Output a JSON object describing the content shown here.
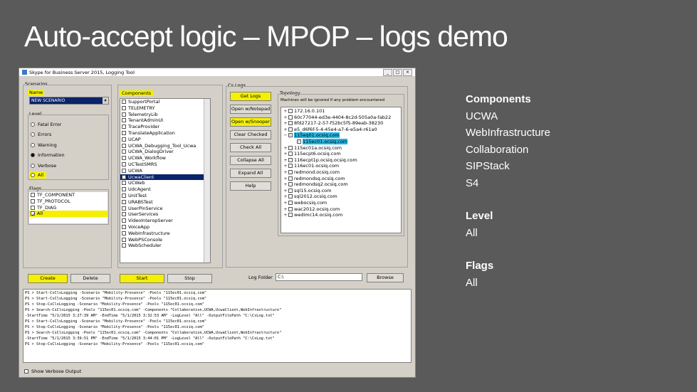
{
  "slide": {
    "title": "Auto-accept logic – MPOP – logs demo",
    "notes": {
      "components_heading": "Components",
      "components": [
        "UCWA",
        "WebInfrastructure",
        "Collaboration",
        "SIPStack",
        "S4"
      ],
      "level_heading": "Level",
      "level_value": "All",
      "flags_heading": "Flags",
      "flags_value": "All"
    }
  },
  "window": {
    "title": "Skype for Business Server 2015, Logging Tool",
    "scenarios": {
      "group_label": "Scenarios",
      "name_label": "Name",
      "name_value": "NEW SCENARIO",
      "level_label": "Level",
      "levels": [
        "Fatal Error",
        "Errors",
        "Warning",
        "Information",
        "Verbose",
        "All"
      ],
      "flags_label": "Flags",
      "flags": [
        "TF_COMPONENT",
        "TF_PROTOCOL",
        "TF_DIAG",
        "All"
      ],
      "create_label": "Create",
      "delete_label": "Delete"
    },
    "components": {
      "label": "Components",
      "items": [
        "SupportPortal",
        "TELEMETRY",
        "TelemetryLib",
        "TenantAdminUI",
        "TraceProvider",
        "TranslateApplication",
        "UCAP",
        "UCWA_Debugging_Tool_Ucwa",
        "UCWA_DialogDriver",
        "UCWA_Workflow",
        "UCTestSMRS",
        "UCWA",
        "UcwaClient",
        "UCWeb",
        "UdcAgent",
        "UnitTest",
        "URABSTest",
        "UserPinService",
        "UserServices",
        "VideoInteropServer",
        "VoiceApp",
        "WebInfrastructure",
        "WebPSConsole",
        "WebScheduler"
      ],
      "selected_index": 12,
      "start_label": "Start",
      "stop_label": "Stop"
    },
    "cs_logs": {
      "label": "Cs Logs",
      "buttons": [
        "Get Logs",
        "Open w/Notepad",
        "Open w/Snooper",
        "Clear Checked",
        "Check All",
        "Collapse All",
        "Expand All",
        "Help"
      ]
    },
    "topology": {
      "label": "Topology",
      "hint": "Machines will be ignored if any problem encountered",
      "nodes": [
        "172.16.0.101",
        "60c77044-ed3e-4404-8c2d-505a0a-fab22",
        "8fd27217-2-57-f52bc5f5-89eab-38230",
        "e5_d6f6f-5-4-45e4-a7-6-e5a4-r61a0",
        "115eq01.ocsiq.com",
        "115ec01.ocsiq.com",
        "115ec01a.ocsiq.com",
        "115ecpt6.ocsiq.com",
        "116ecpt1p.ocsiq.ocsiq.com",
        "116ec01.ocsiq.com",
        "redmond.ocsiq.com",
        "redmondsq.ocsiq.com",
        "redmondsq2.ocsiq.com",
        "sql15.ocsiq.com",
        "sql2012.ocsiq.com",
        "webocsiq.com",
        "wac2012.ocsiq.com",
        "wedimc14.ocsiq.com"
      ],
      "log_folder_label": "Log Folder",
      "log_folder_value": "C:\\",
      "browse_label": "Browse"
    },
    "output_lines": [
      "PS > Start-CsClsLogging -Scenario \"Mobility-Presence\" -Pools \"115ec01.ocsiq.com\"",
      "PS > Start-CsClsLogging -Scenario \"Mobility-Presence\" -Pools \"115ec01.ocsiq.com\"",
      "PS > Stop-CsClsLogging -Scenario \"Mobility-Presence\" -Pools \"115ec01.ocsiq.com\"",
      "PS > Search-CsClsLogging -Pools \"115ec01.ocsiq.com\" -Components \"Collaboration,UCWA,UcwaClient,WebInfrastructure\"",
      "-StartTime \"5/1/2015 3:27:39 AM\" -EndTime \"5/1/2015 3:32:53 AM\" -LogLevel \"All\" -OutputFilePath \"C:\\CsLog.txt\"",
      "PS > Start-CsClsLogging -Scenario \"Mobility-Presence\" -Pools \"115ec01.ocsiq.com\"",
      "PS > Stop-CsClsLogging -Scenario \"Mobility-Presence\" -Pools \"115ec01.ocsiq.com\"",
      "PS > Search-CsClsLogging -Pools \"115ec01.ocsiq.com\" -Components \"Collaboration,UCWA,UcwaClient,WebInfrastructure\"",
      "-StartTime \"5/1/2015 3:39:51 PM\" -EndTime \"5/1/2015 3:44:01 PM\" -LogLevel \"All\" -OutputFilePath \"C:\\CsLog.txt\"",
      "PS > Stop-CsClsLogging -Scenario \"Mobility-Presence\" -Pools \"115ec01.ocsiq.com\""
    ],
    "verbose_label": "Show Verbose Output"
  }
}
